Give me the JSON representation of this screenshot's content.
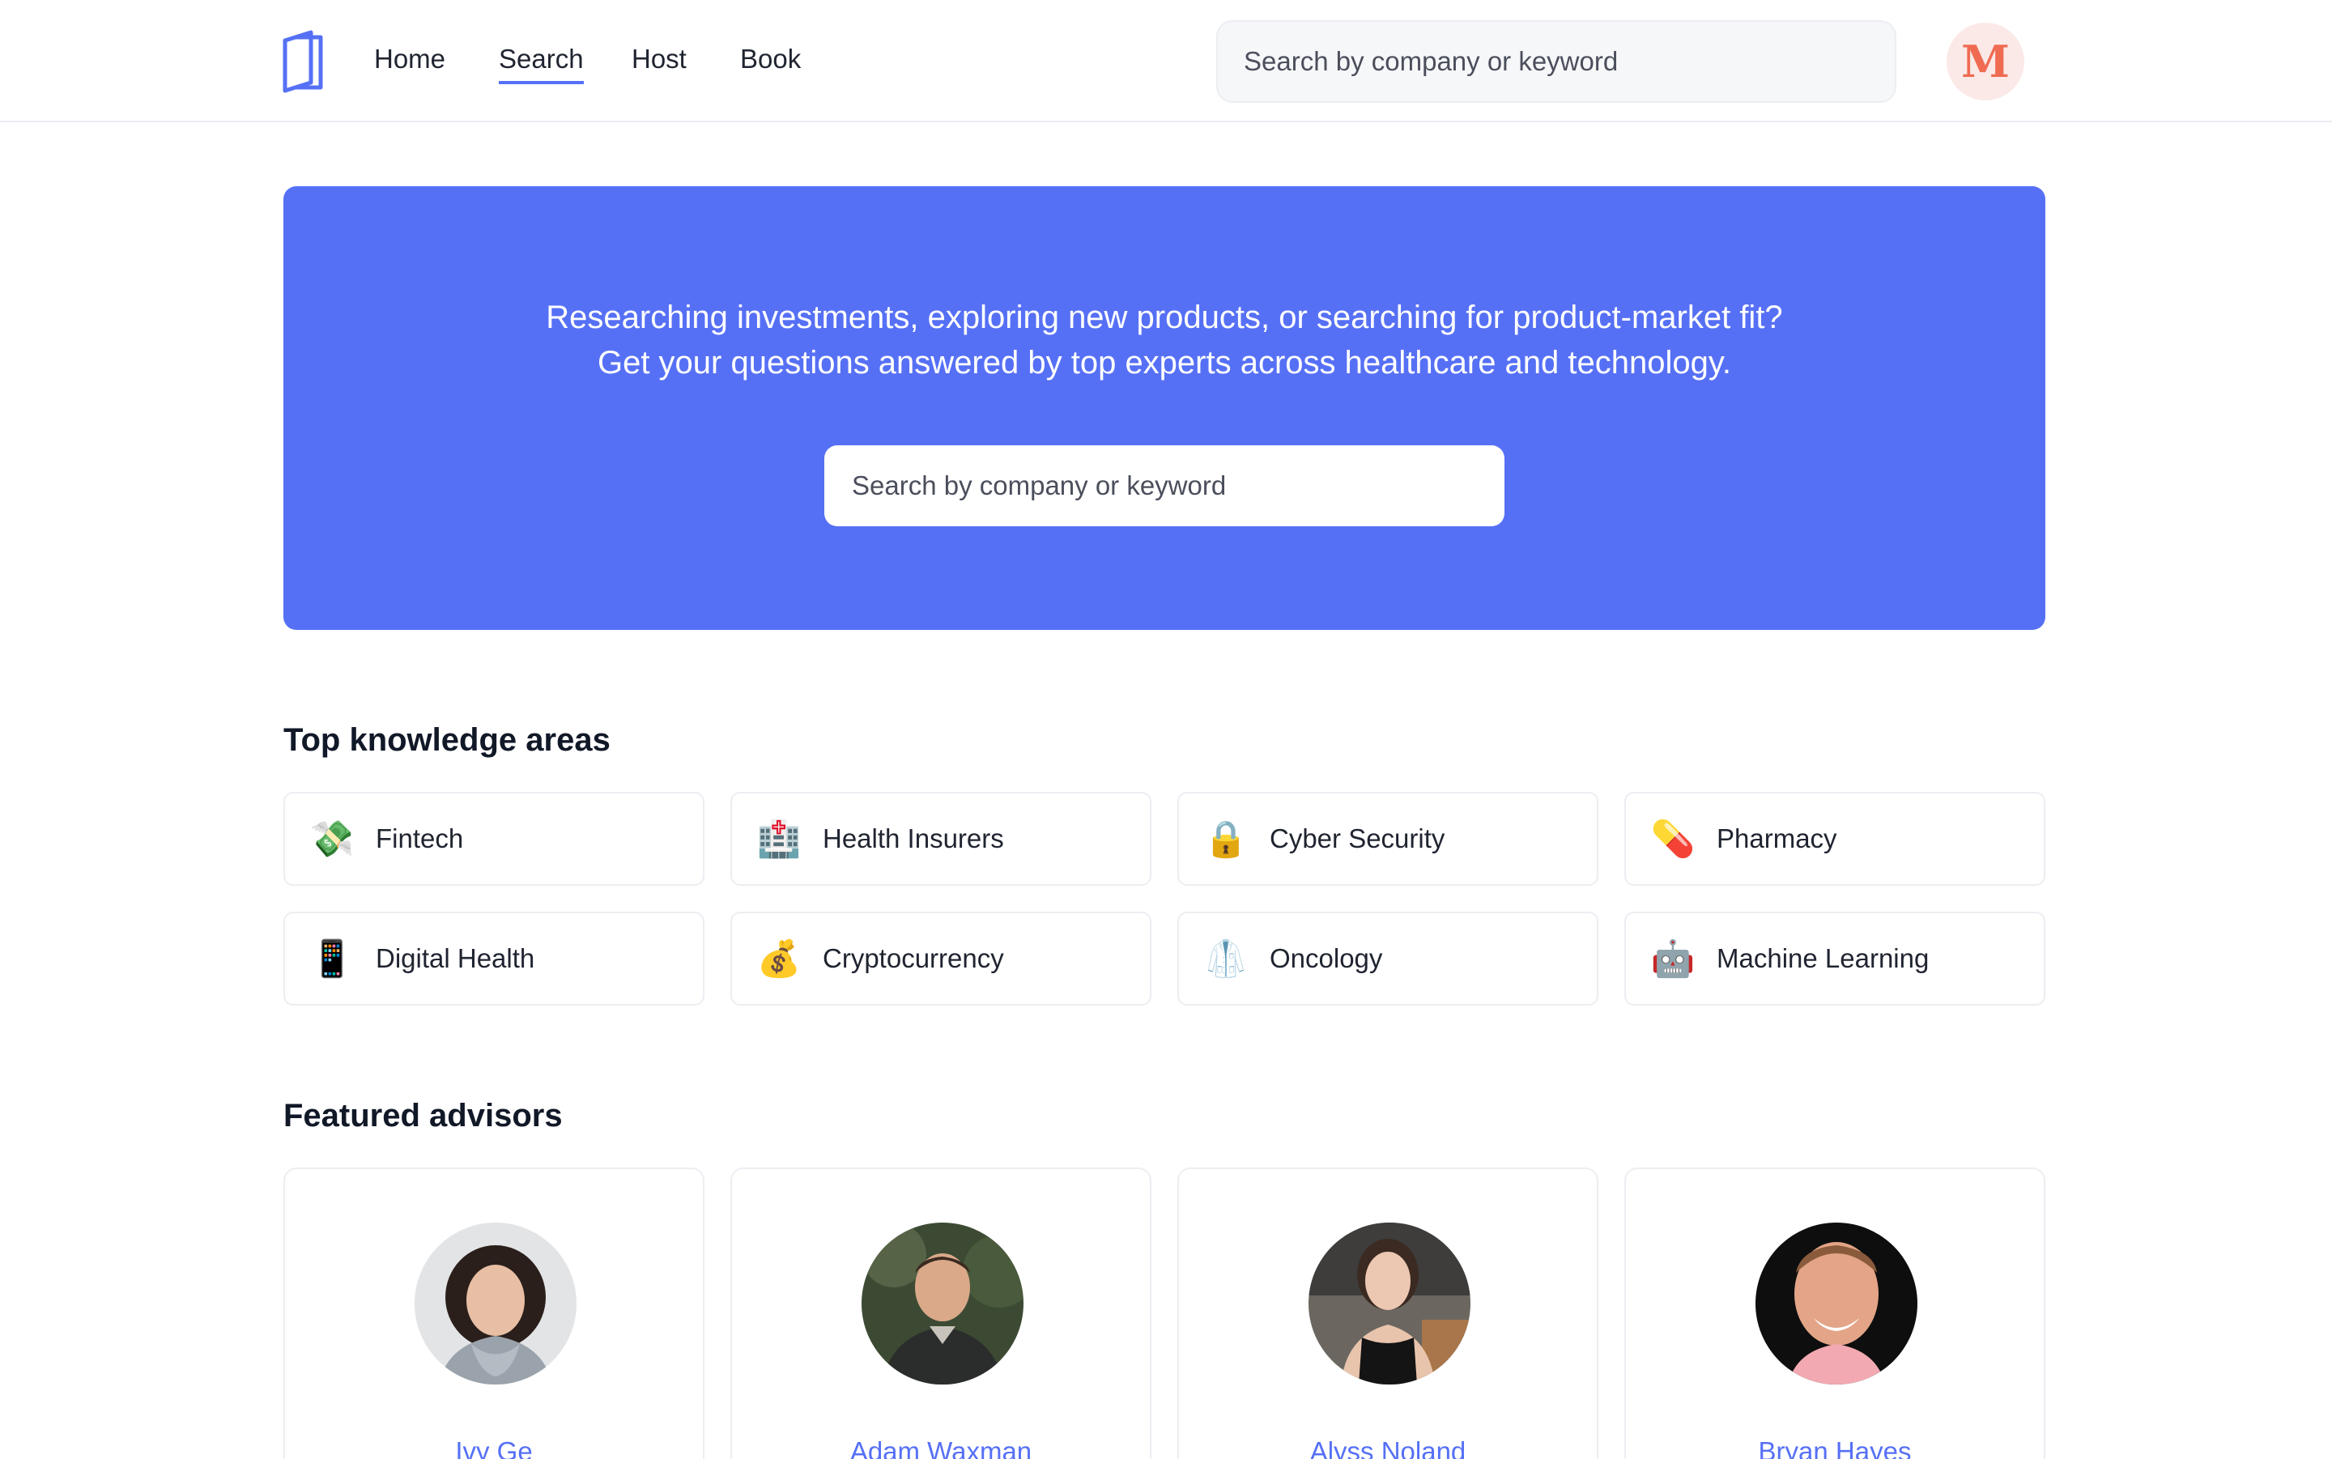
{
  "nav": {
    "links": [
      {
        "label": "Home",
        "active": false
      },
      {
        "label": "Search",
        "active": true
      },
      {
        "label": "Host",
        "active": false
      },
      {
        "label": "Book",
        "active": false
      }
    ],
    "search_placeholder": "Search by company or keyword",
    "avatar_initial": "M"
  },
  "hero": {
    "line1": "Researching investments, exploring new products, or searching for product-market fit?",
    "line2": "Get your questions answered by top experts across healthcare and technology.",
    "search_placeholder": "Search by company or keyword"
  },
  "areas": {
    "title": "Top knowledge areas",
    "items": [
      {
        "label": "Fintech",
        "icon": "money-with-wings-icon",
        "glyph": "💸"
      },
      {
        "label": "Health Insurers",
        "icon": "hospital-icon",
        "glyph": "🏥"
      },
      {
        "label": "Cyber Security",
        "icon": "lock-icon",
        "glyph": "🔒"
      },
      {
        "label": "Pharmacy",
        "icon": "pill-icon",
        "glyph": "💊"
      },
      {
        "label": "Digital Health",
        "icon": "mobile-phone-icon",
        "glyph": "📱"
      },
      {
        "label": "Cryptocurrency",
        "icon": "money-bag-icon",
        "glyph": "💰"
      },
      {
        "label": "Oncology",
        "icon": "lab-coat-icon",
        "glyph": "🥼"
      },
      {
        "label": "Machine Learning",
        "icon": "robot-icon",
        "glyph": "🤖"
      }
    ]
  },
  "advisors": {
    "title": "Featured advisors",
    "items": [
      {
        "name": "Ivy Ge"
      },
      {
        "name": "Adam Waxman"
      },
      {
        "name": "Alyss Noland"
      },
      {
        "name": "Bryan Hayes"
      }
    ]
  },
  "colors": {
    "accent": "#5670f5",
    "avatar_bg": "#fbe9e7",
    "avatar_text": "#ef6b52",
    "border": "#eceef2"
  }
}
